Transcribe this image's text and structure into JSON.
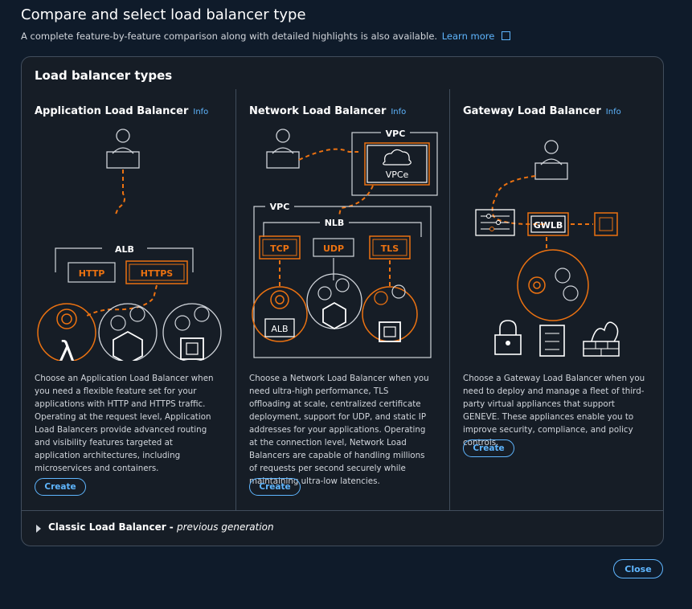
{
  "header": {
    "title": "Compare and select load balancer type",
    "subtitle": "A complete feature-by-feature comparison along with detailed highlights is also available.",
    "learn_more": "Learn more"
  },
  "panel": {
    "title": "Load balancer types",
    "info_label": "Info",
    "create_label": "Create",
    "columns": [
      {
        "title": "Application Load Balancer",
        "diagram": {
          "group": "ALB",
          "protocols": [
            "HTTP",
            "HTTPS"
          ]
        },
        "description": "Choose an Application Load Balancer when you need a flexible feature set for your applications with HTTP and HTTPS traffic. Operating at the request level, Application Load Balancers provide advanced routing and visibility features targeted at application architectures, including microservices and containers."
      },
      {
        "title": "Network Load Balancer",
        "diagram": {
          "vpc_top": "VPC",
          "endpoint": "VPCe",
          "vpc": "VPC",
          "group": "NLB",
          "protocols": [
            "TCP",
            "UDP",
            "TLS"
          ],
          "target": "ALB"
        },
        "description": "Choose a Network Load Balancer when you need ultra-high performance, TLS offloading at scale, centralized certificate deployment, support for UDP, and static IP addresses for your applications. Operating at the connection level, Network Load Balancers are capable of handling millions of requests per second securely while maintaining ultra-low latencies."
      },
      {
        "title": "Gateway Load Balancer",
        "diagram": {
          "group": "GWLB"
        },
        "description": "Choose a Gateway Load Balancer when you need to deploy and manage a fleet of third-party virtual appliances that support GENEVE. These appliances enable you to improve security, compliance, and policy controls."
      }
    ]
  },
  "classic": {
    "label": "Classic Load Balancer - ",
    "suffix": "previous generation"
  },
  "footer": {
    "close_label": "Close"
  },
  "colors": {
    "accent": "#ec7211",
    "link": "#5fb6ff",
    "background": "#0f1b2a",
    "panel": "#161d26"
  }
}
